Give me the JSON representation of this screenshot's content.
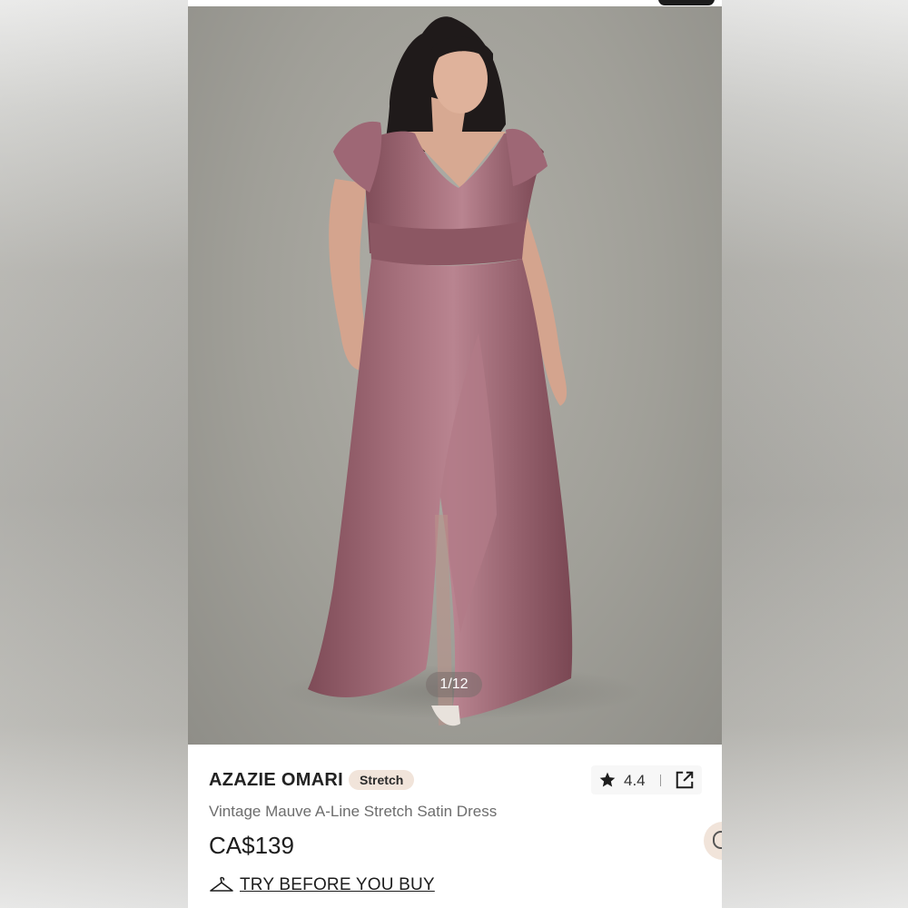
{
  "gallery": {
    "counter": "1/12"
  },
  "product": {
    "brand": "AZAZIE OMARI",
    "badge": "Stretch",
    "title": "Vintage Mauve A-Line Stretch Satin Dress",
    "price": "CA$139",
    "rating": "4.4",
    "try_before_label": "TRY BEFORE YOU BUY"
  },
  "icons": {
    "rating": "star-icon",
    "share": "share-icon",
    "try_before": "hanger-icon",
    "chat": "chat-icon"
  },
  "colors": {
    "dress": "#9a5f6c",
    "badge_bg": "#f1e4da",
    "backdrop": "#a09f98",
    "text_primary": "#222222",
    "text_secondary": "#6d6d6d"
  }
}
